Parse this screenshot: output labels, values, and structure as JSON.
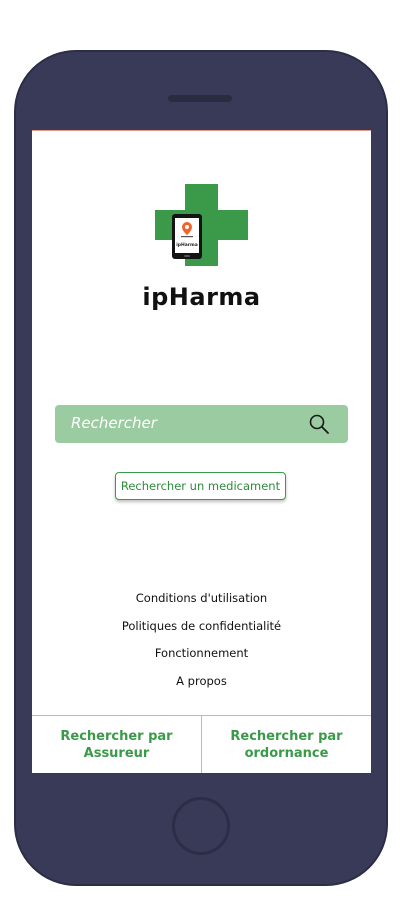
{
  "app": {
    "title": "ipHarma",
    "logo_text": "ipHarma"
  },
  "search": {
    "placeholder": "Rechercher",
    "icon": "search-icon"
  },
  "actions": {
    "search_medicine_label": "Rechercher un medicament"
  },
  "footer_links": [
    {
      "label": "Conditions d'utilisation"
    },
    {
      "label": "Politiques de confidentialité"
    },
    {
      "label": "Fonctionnement"
    },
    {
      "label": "A propos"
    }
  ],
  "bottom_nav": [
    {
      "label": "Rechercher par\nAssureur"
    },
    {
      "label": "Rechercher par\nordornance"
    }
  ],
  "colors": {
    "brand_green": "#3a9a49",
    "search_bg": "#9bcba0",
    "phone_body": "#383a57",
    "pin_orange": "#f0642a"
  }
}
